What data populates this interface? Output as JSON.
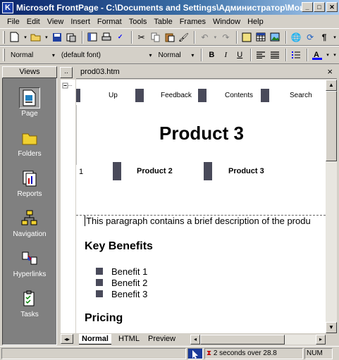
{
  "window": {
    "title": "Microsoft FrontPage - C:\\Documents and Settings\\Администратор\\Мои доку...",
    "icon": "frontpage-icon"
  },
  "menu": [
    "File",
    "Edit",
    "View",
    "Insert",
    "Format",
    "Tools",
    "Table",
    "Frames",
    "Window",
    "Help"
  ],
  "formatting": {
    "style": "Normal",
    "font": "(default font)",
    "size": "Normal"
  },
  "views": {
    "header": "Views",
    "items": [
      {
        "label": "Page",
        "icon": "page-icon"
      },
      {
        "label": "Folders",
        "icon": "folder-icon"
      },
      {
        "label": "Reports",
        "icon": "reports-icon"
      },
      {
        "label": "Navigation",
        "icon": "navigation-icon"
      },
      {
        "label": "Hyperlinks",
        "icon": "hyperlinks-icon"
      },
      {
        "label": "Tasks",
        "icon": "tasks-icon"
      }
    ]
  },
  "folder_list_button": "..",
  "document": {
    "tab": "prod03.htm",
    "nav_top": [
      "Up",
      "Feedback",
      "Contents",
      "Search"
    ],
    "heading": "Product 3",
    "nav_products": [
      "1",
      "Product 2",
      "Product 3"
    ],
    "paragraph": "This paragraph contains a brief description of the produ",
    "key_benefits": "Key Benefits",
    "benefits": [
      "Benefit 1",
      "Benefit 2",
      "Benefit 3"
    ],
    "pricing": "Pricing"
  },
  "view_tabs": [
    "Normal",
    "HTML",
    "Preview"
  ],
  "status": {
    "time": "2 seconds over 28.8",
    "num": "NUM"
  },
  "colors": {
    "title_bar": "#0a246a",
    "nav_block": "#494a5a"
  }
}
